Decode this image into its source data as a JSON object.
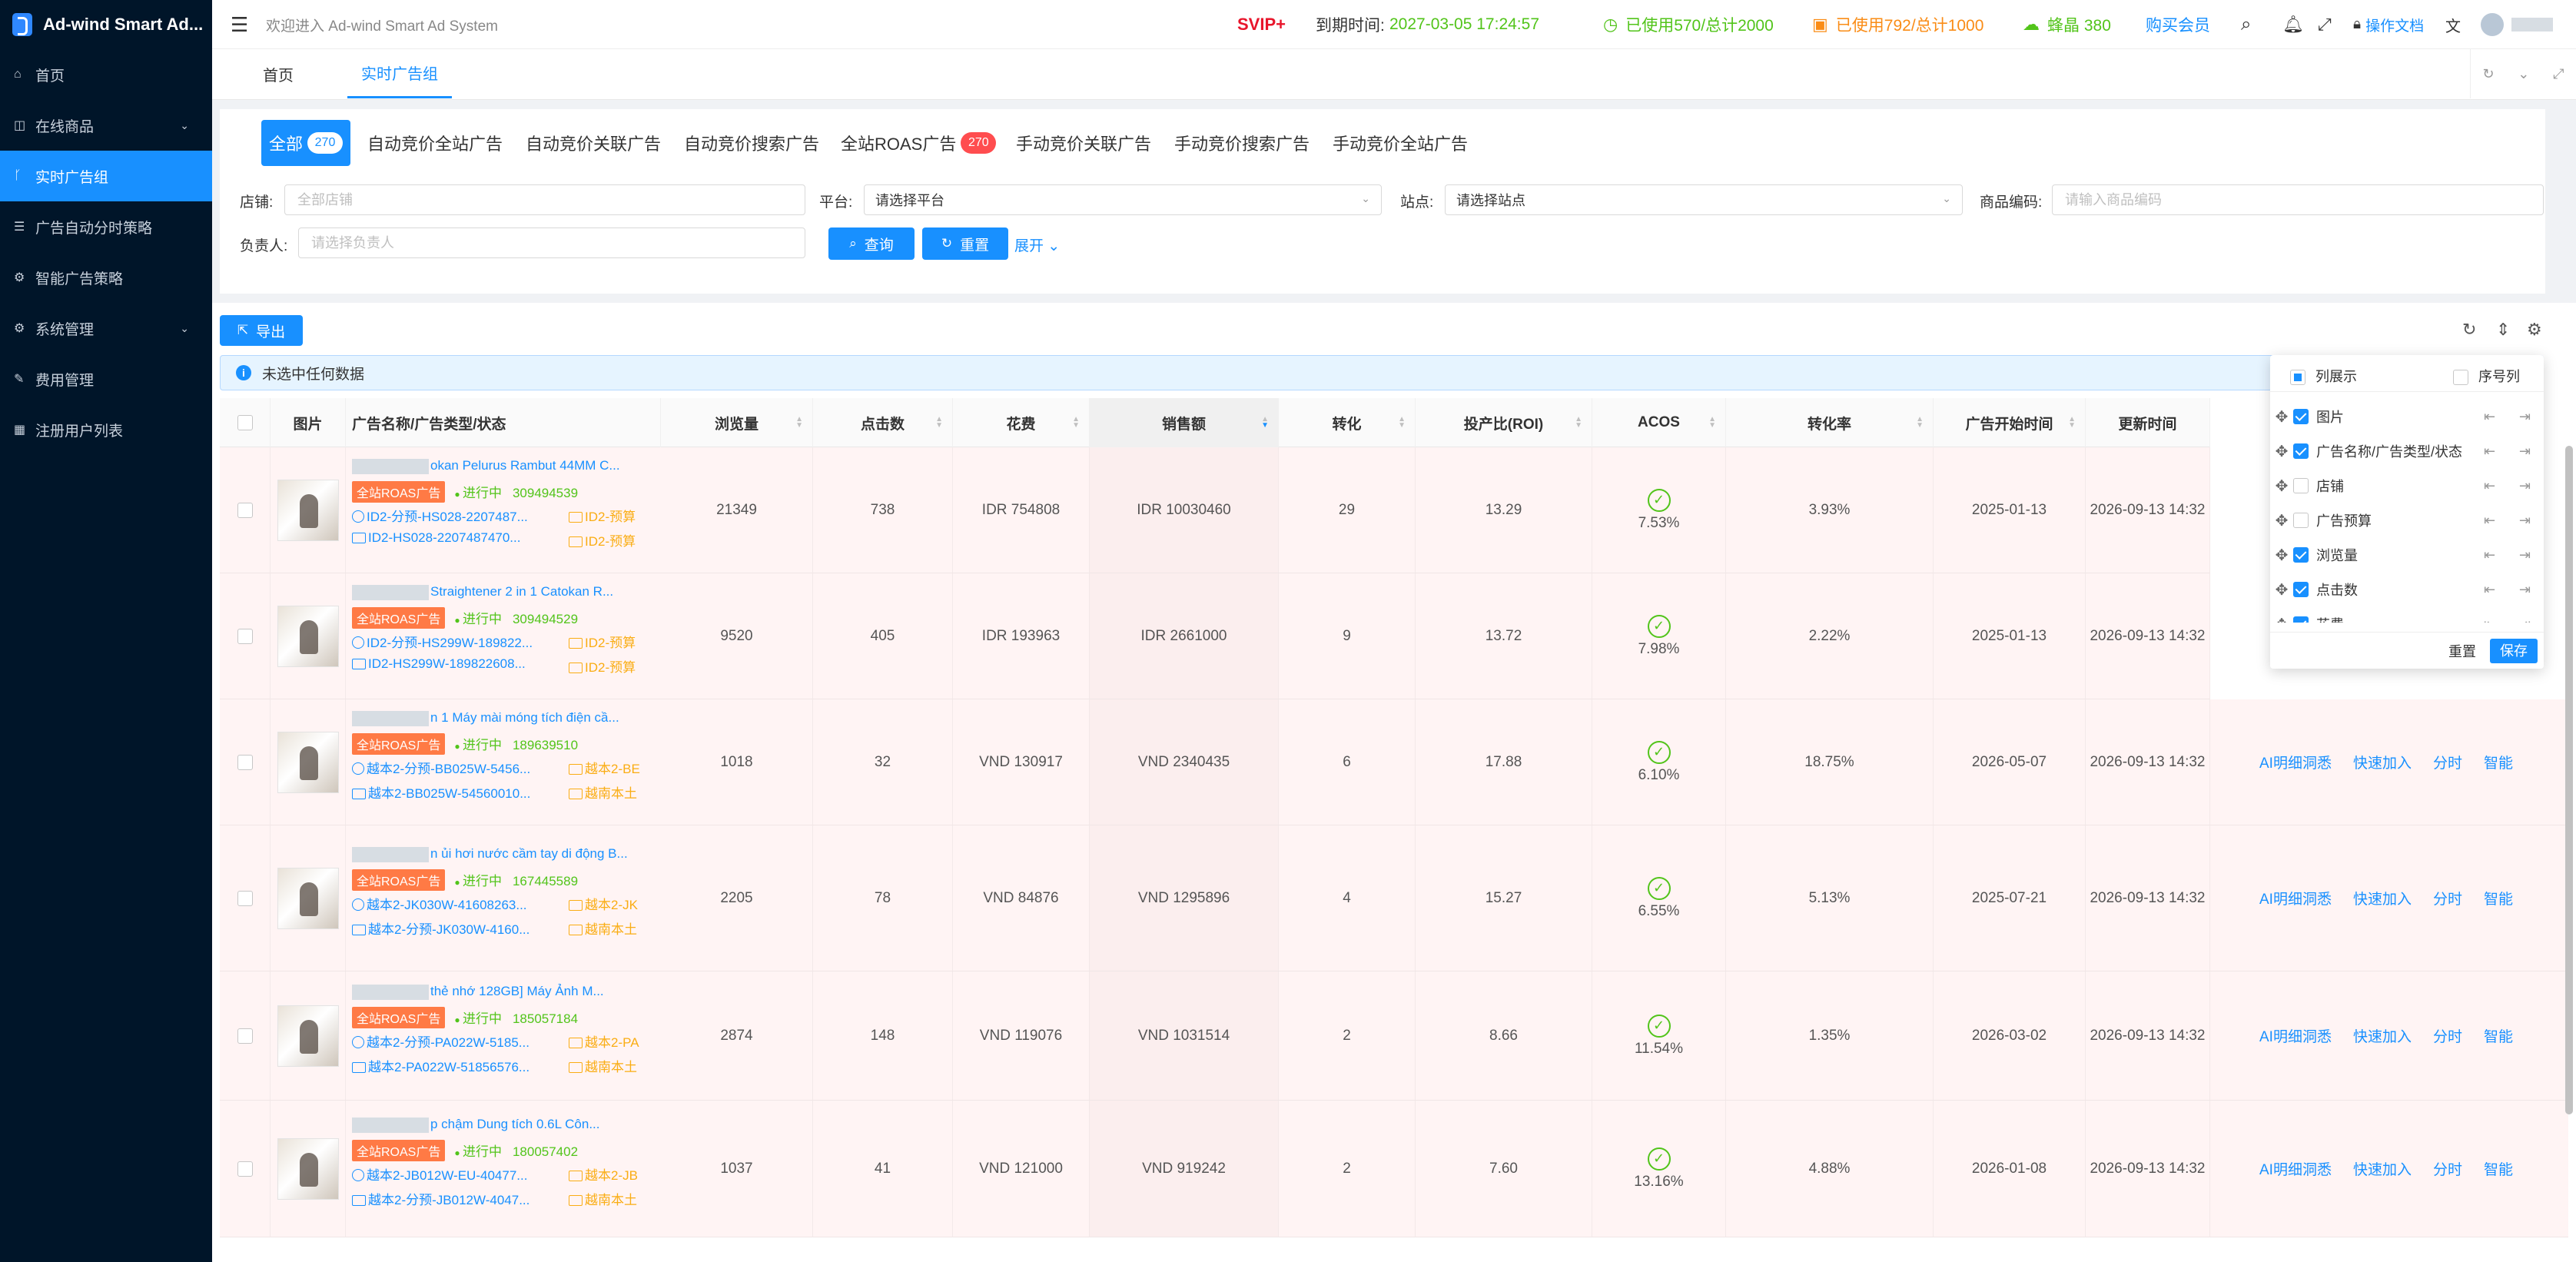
{
  "app": {
    "name": "Ad-wind Smart Ad..."
  },
  "sidebar": {
    "items": [
      {
        "label": "首页",
        "icon": "home-icon",
        "glyph": "⌂"
      },
      {
        "label": "在线商品",
        "icon": "shop-icon",
        "glyph": "◫",
        "arrow": true
      },
      {
        "label": "实时广告组",
        "icon": "branch-icon",
        "glyph": "ᚴ",
        "active": true
      },
      {
        "label": "广告自动分时策略",
        "icon": "list-icon",
        "glyph": "☰"
      },
      {
        "label": "智能广告策略",
        "icon": "gear-icon",
        "glyph": "⚙"
      },
      {
        "label": "系统管理",
        "icon": "settings-icon",
        "glyph": "⚙",
        "arrow": true
      },
      {
        "label": "费用管理",
        "icon": "edit-icon",
        "glyph": "✎"
      },
      {
        "label": "注册用户列表",
        "icon": "table-icon",
        "glyph": "▦"
      }
    ]
  },
  "header": {
    "welcome": "欢迎进入 Ad-wind Smart Ad System",
    "svip": "SVIP+",
    "expire_label": "到期时间:",
    "expire_value": "2027-03-05 17:24:57",
    "used_a": "已使用570/总计2000",
    "used_b": "已使用792/总计1000",
    "bee": "蜂晶 380",
    "buy": "购买会员",
    "docs": "操作文档"
  },
  "tabs": {
    "home": "首页",
    "current": "实时广告组"
  },
  "type_tabs": [
    {
      "label": "全部",
      "badge": "270",
      "active": true
    },
    {
      "label": "自动竞价全站广告"
    },
    {
      "label": "自动竞价关联广告"
    },
    {
      "label": "自动竞价搜索广告"
    },
    {
      "label": "全站ROAS广告",
      "badge": "270",
      "red": true
    },
    {
      "label": "手动竞价关联广告"
    },
    {
      "label": "手动竞价搜索广告"
    },
    {
      "label": "手动竞价全站广告"
    }
  ],
  "filters": {
    "shop_label": "店铺:",
    "shop_placeholder": "全部店铺",
    "platform_label": "平台:",
    "platform_placeholder": "请选择平台",
    "site_label": "站点:",
    "site_placeholder": "请选择站点",
    "sku_label": "商品编码:",
    "sku_placeholder": "请输入商品编码",
    "owner_label": "负责人:",
    "owner_placeholder": "请选择负责人",
    "query": "查询",
    "reset": "重置",
    "expand": "展开"
  },
  "toolbar": {
    "export": "导出",
    "selection_info": "未选中任何数据"
  },
  "table": {
    "headers": [
      "图片",
      "广告名称/广告类型/状态",
      "浏览量",
      "点击数",
      "花费",
      "销售额",
      "转化",
      "投产比(ROI)",
      "ACOS",
      "转化率",
      "广告开始时间",
      "更新时间"
    ],
    "rows": [
      {
        "title": "okan Pelurus Rambut 44MM C...",
        "status": "进行中",
        "id": "309494539",
        "sub1": "ID2-分预-HS028-2207487...",
        "sub2": "ID2-HS028-2207487470...",
        "o1": "ID2-预算",
        "o2": "ID2-预算",
        "views": "21349",
        "clicks": "738",
        "spend": "IDR 754808",
        "sales": "IDR 10030460",
        "conv": "29",
        "roi": "13.29",
        "acos": "7.53%",
        "rate": "3.93%",
        "start": "2025-01-13",
        "update": "2026-09-13 14:32"
      },
      {
        "title": "Straightener 2 in 1 Catokan R...",
        "status": "进行中",
        "id": "309494529",
        "sub1": "ID2-分预-HS299W-189822...",
        "sub2": "ID2-HS299W-189822608...",
        "o1": "ID2-预算",
        "o2": "ID2-预算",
        "views": "9520",
        "clicks": "405",
        "spend": "IDR 193963",
        "sales": "IDR 2661000",
        "conv": "9",
        "roi": "13.72",
        "acos": "7.98%",
        "rate": "2.22%",
        "start": "2025-01-13",
        "update": "2026-09-13 14:32"
      },
      {
        "title": "n 1 Máy mài móng tích điện cầ...",
        "status": "进行中",
        "id": "189639510",
        "sub1": "越本2-分预-BB025W-5456...",
        "sub2": "越本2-BB025W-54560010...",
        "o1": "越本2-BE",
        "o2": "越南本土",
        "views": "1018",
        "clicks": "32",
        "spend": "VND 130917",
        "sales": "VND 2340435",
        "conv": "6",
        "roi": "17.88",
        "acos": "6.10%",
        "rate": "18.75%",
        "start": "2026-05-07",
        "update": "2026-09-13 14:32"
      },
      {
        "title": "n ủi hơi nước cầm tay di động B...",
        "status": "进行中",
        "id": "167445589",
        "sub1": "越本2-JK030W-41608263...",
        "sub2": "越本2-分预-JK030W-4160...",
        "o1": "越本2-JK",
        "o2": "越南本土",
        "views": "2205",
        "clicks": "78",
        "spend": "VND 84876",
        "sales": "VND 1295896",
        "conv": "4",
        "roi": "15.27",
        "acos": "6.55%",
        "rate": "5.13%",
        "start": "2025-07-21",
        "update": "2026-09-13 14:32"
      },
      {
        "title": "thẻ nhớ 128GB] Máy Ảnh M...",
        "status": "进行中",
        "id": "185057184",
        "sub1": "越本2-分预-PA022W-5185...",
        "sub2": "越本2-PA022W-51856576...",
        "o1": "越本2-PA",
        "o2": "越南本土",
        "views": "2874",
        "clicks": "148",
        "spend": "VND 119076",
        "sales": "VND 1031514",
        "conv": "2",
        "roi": "8.66",
        "acos": "11.54%",
        "rate": "1.35%",
        "start": "2026-03-02",
        "update": "2026-09-13 14:32"
      },
      {
        "title": "p chậm Dung tích 0.6L Côn...",
        "status": "进行中",
        "id": "180057402",
        "sub1": "越本2-JB012W-EU-40477...",
        "sub2": "越本2-分预-JB012W-4047...",
        "o1": "越本2-JB",
        "o2": "越南本土",
        "views": "1037",
        "clicks": "41",
        "spend": "VND 121000",
        "sales": "VND 919242",
        "conv": "2",
        "roi": "7.60",
        "acos": "13.16%",
        "rate": "4.88%",
        "start": "2026-01-08",
        "update": "2026-09-13 14:32"
      }
    ],
    "tag": "全站ROAS广告",
    "actions": [
      "AI明细洞悉",
      "快速加入",
      "分时",
      "智能"
    ]
  },
  "column_settings": {
    "title": "列展示",
    "index_col": "序号列",
    "items": [
      {
        "label": "图片",
        "checked": true
      },
      {
        "label": "广告名称/广告类型/状态",
        "checked": true
      },
      {
        "label": "店铺",
        "checked": false
      },
      {
        "label": "广告预算",
        "checked": false
      },
      {
        "label": "浏览量",
        "checked": true
      },
      {
        "label": "点击数",
        "checked": true
      },
      {
        "label": "花费",
        "checked": true
      }
    ],
    "reset": "重置",
    "save": "保存"
  }
}
